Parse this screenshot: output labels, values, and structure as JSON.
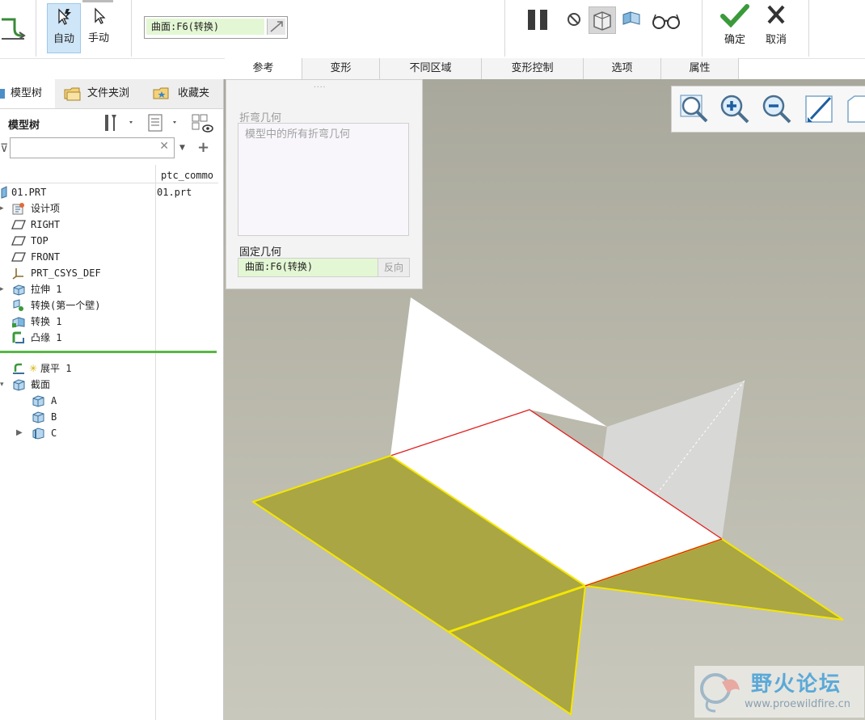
{
  "ribbon": {
    "auto_label": "自动",
    "manual_label": "手动",
    "collector_value": "曲面:F6(转换)",
    "ok_label": "确定",
    "cancel_label": "取消"
  },
  "tabs": [
    {
      "label": "参考"
    },
    {
      "label": "变形"
    },
    {
      "label": "不同区域"
    },
    {
      "label": "变形控制"
    },
    {
      "label": "选项"
    },
    {
      "label": "属性"
    }
  ],
  "navigator": {
    "tabs": [
      {
        "label": "模型树"
      },
      {
        "label": "文件夹浏"
      },
      {
        "label": "收藏夹"
      }
    ],
    "header_title": "模型树",
    "column_header": "ptc_commo",
    "column_value": "01.prt",
    "items": [
      {
        "label": "01.PRT"
      },
      {
        "label": "设计项"
      },
      {
        "label": "RIGHT"
      },
      {
        "label": "TOP"
      },
      {
        "label": "FRONT"
      },
      {
        "label": "PRT_CSYS_DEF"
      },
      {
        "label": "拉伸 1"
      },
      {
        "label": "转换(第一个壁)"
      },
      {
        "label": "转换 1"
      },
      {
        "label": "凸缘 1"
      },
      {
        "label": "展平 1"
      },
      {
        "label": "截面"
      },
      {
        "label": "A"
      },
      {
        "label": "B"
      },
      {
        "label": "C"
      }
    ]
  },
  "references_panel": {
    "bend_label": "折弯几何",
    "bend_placeholder": "模型中的所有折弯几何",
    "fixed_label": "固定几何",
    "fixed_value": "曲面:F6(转换)",
    "flip_label": "反向"
  },
  "watermark": {
    "title": "野火论坛",
    "url": "www.proewildfire.cn"
  },
  "colors": {
    "accent_green": "#57b845",
    "selection_yellow": "#f5e600",
    "flat_face": "#a9a643",
    "edge_red": "#e0201e"
  }
}
